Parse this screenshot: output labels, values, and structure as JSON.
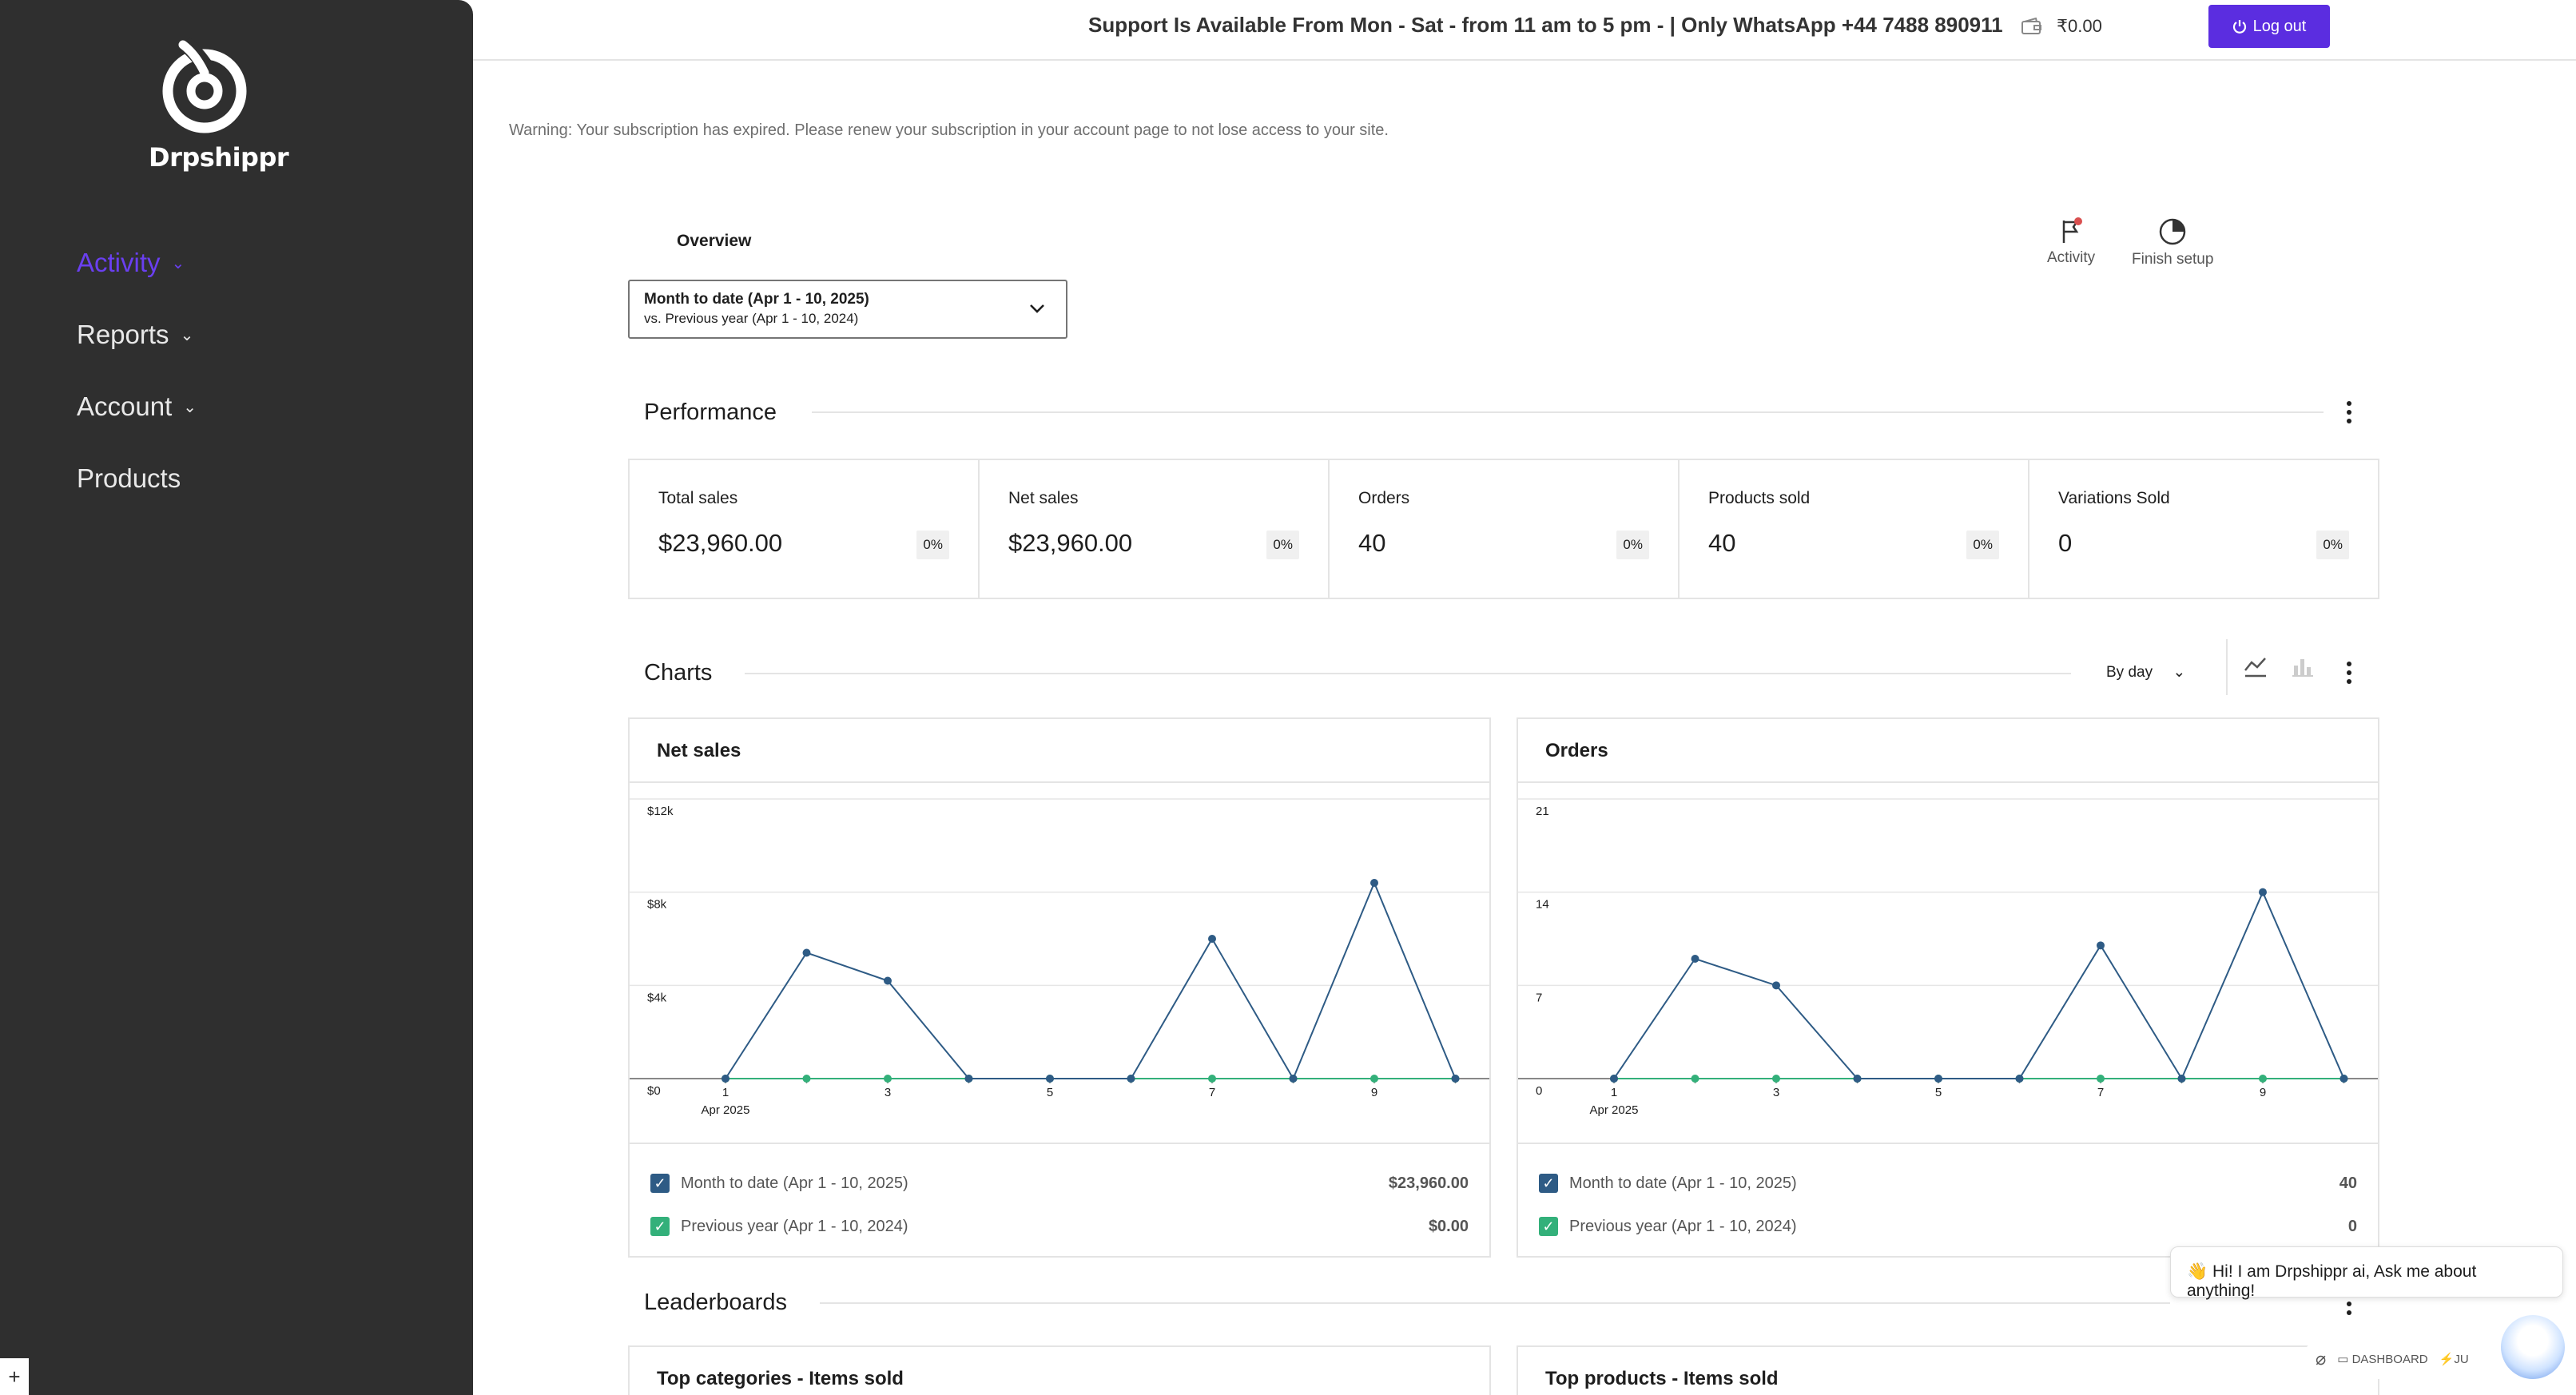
{
  "sidebar": {
    "brand": "Drpshippr",
    "items": [
      {
        "label": "Activity",
        "active": true,
        "has_chevron": true
      },
      {
        "label": "Reports",
        "active": false,
        "has_chevron": true
      },
      {
        "label": "Account",
        "active": false,
        "has_chevron": true
      },
      {
        "label": "Products",
        "active": false,
        "has_chevron": false
      }
    ]
  },
  "topbar": {
    "support_text": "Support Is Available From Mon - Sat - from 11 am to 5 pm - | Only WhatsApp +44 7488 890911",
    "wallet_amount": "₹0.00",
    "logout_label": "Log out"
  },
  "warning": "Warning: Your subscription has expired. Please renew your subscription in your account page to not lose access to your site.",
  "overview": {
    "title": "Overview",
    "activity_label": "Activity",
    "finish_setup_label": "Finish setup",
    "date_range": "Month to date (Apr 1 - 10, 2025)",
    "compare_range": "vs. Previous year (Apr 1 - 10, 2024)"
  },
  "performance": {
    "title": "Performance",
    "kpis": [
      {
        "label": "Total sales",
        "value": "$23,960.00",
        "change": "0%"
      },
      {
        "label": "Net sales",
        "value": "$23,960.00",
        "change": "0%"
      },
      {
        "label": "Orders",
        "value": "40",
        "change": "0%"
      },
      {
        "label": "Products sold",
        "value": "40",
        "change": "0%"
      },
      {
        "label": "Variations Sold",
        "value": "0",
        "change": "0%"
      }
    ]
  },
  "charts_section": {
    "title": "Charts",
    "interval": "By day"
  },
  "colors": {
    "accent": "#5b2de0",
    "sidebar_active": "#6a3ff0",
    "series_current": "#2e5b85",
    "series_previous": "#33b07a"
  },
  "chart_data": [
    {
      "type": "line",
      "title": "Net sales",
      "x": [
        1,
        2,
        3,
        4,
        5,
        6,
        7,
        8,
        9,
        10
      ],
      "x_tick_labels": [
        "1",
        "3",
        "5",
        "7",
        "9"
      ],
      "x_sublabel": "Apr 2025",
      "y_ticks": [
        "$0",
        "$4k",
        "$8k",
        "$12k"
      ],
      "ylim": [
        0,
        12000
      ],
      "series": [
        {
          "name": "Month to date (Apr 1 - 10, 2025)",
          "values": [
            0,
            5400,
            4200,
            0,
            0,
            0,
            6000,
            0,
            8400,
            0
          ],
          "total": "$23,960.00"
        },
        {
          "name": "Previous year (Apr 1 - 10, 2024)",
          "values": [
            0,
            0,
            0,
            0,
            0,
            0,
            0,
            0,
            0,
            0
          ],
          "total": "$0.00"
        }
      ]
    },
    {
      "type": "line",
      "title": "Orders",
      "x": [
        1,
        2,
        3,
        4,
        5,
        6,
        7,
        8,
        9,
        10
      ],
      "x_tick_labels": [
        "1",
        "3",
        "5",
        "7",
        "9"
      ],
      "x_sublabel": "Apr 2025",
      "y_ticks": [
        "0",
        "7",
        "14",
        "21"
      ],
      "ylim": [
        0,
        21
      ],
      "series": [
        {
          "name": "Month to date (Apr 1 - 10, 2025)",
          "values": [
            0,
            9,
            7,
            0,
            0,
            0,
            10,
            0,
            14,
            0
          ],
          "total": "40"
        },
        {
          "name": "Previous year (Apr 1 - 10, 2024)",
          "values": [
            0,
            0,
            0,
            0,
            0,
            0,
            0,
            0,
            0,
            0
          ],
          "total": "0"
        }
      ]
    }
  ],
  "leaderboards": {
    "title": "Leaderboards",
    "cards": [
      "Top categories - Items sold",
      "Top products - Items sold"
    ]
  },
  "chat": {
    "greeting": "👋 Hi! I am Drpshippr ai, Ask me about anything!",
    "dashboard_label": "DASHBOARD",
    "ju_label": "JU"
  }
}
